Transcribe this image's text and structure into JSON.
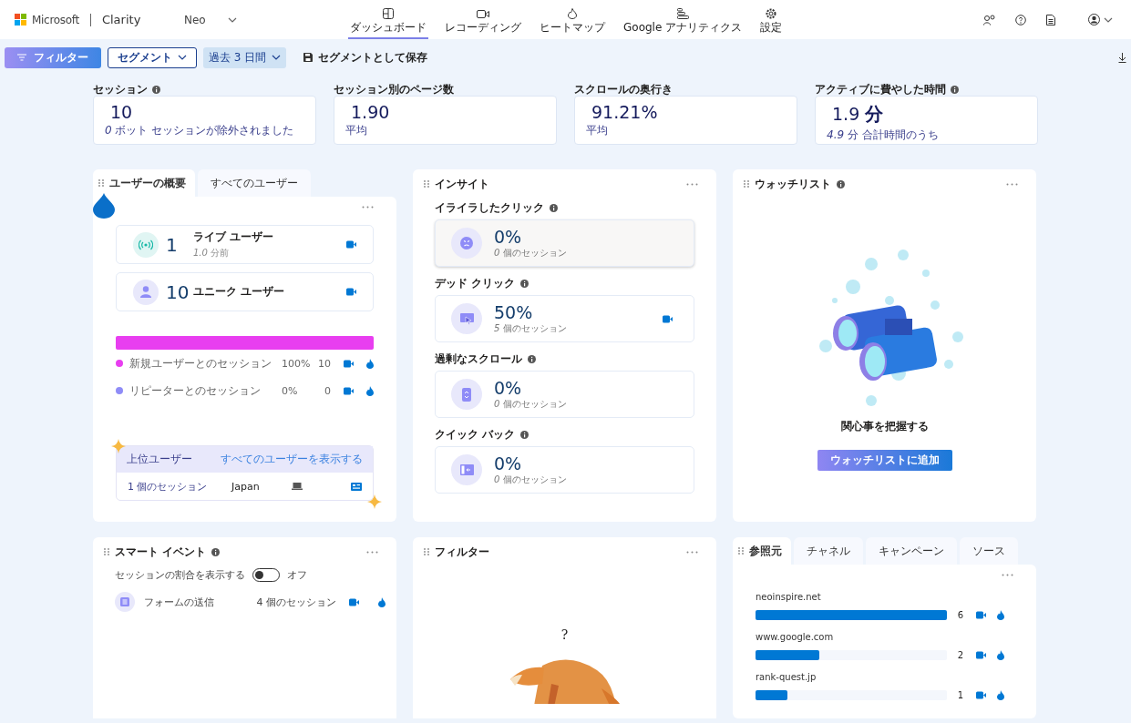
{
  "header": {
    "brand": "Microsoft",
    "product": "Clarity",
    "project": "Neo",
    "nav": [
      {
        "label": "ダッシュボード",
        "selected": true
      },
      {
        "label": "レコーディング",
        "selected": false
      },
      {
        "label": "ヒートマップ",
        "selected": false
      },
      {
        "label": "Google アナリティクス",
        "selected": false
      },
      {
        "label": "設定",
        "selected": false
      }
    ]
  },
  "toolbar": {
    "filter_button": "フィルター",
    "segment_button": "セグメント",
    "date_range": "過去 3 日間",
    "save_segment": "セグメントとして保存"
  },
  "stats": [
    {
      "label": "セッション",
      "info": true,
      "value": "10",
      "note": "*0* ボット セッションが除外されました"
    },
    {
      "label": "セッション別のページ数",
      "info": false,
      "value": "1.90",
      "note": "平均"
    },
    {
      "label": "スクロールの奥行き",
      "info": false,
      "value": "91.21%",
      "note": "平均"
    },
    {
      "label": "アクティブに費やした時間",
      "info": true,
      "value": "1.9 **分**",
      "note": "*4.9* 分 合計時間のうち"
    }
  ],
  "user_overview": {
    "tabs": [
      {
        "label": "ユーザーの概要",
        "selected": true
      },
      {
        "label": "すべてのユーザー",
        "selected": false
      }
    ],
    "users": [
      {
        "value": "1",
        "label": "ライブ ユーザー",
        "sub": "*1.0* 分前"
      },
      {
        "value": "10",
        "label": "ユニーク ユーザー"
      }
    ],
    "segments": [
      {
        "label": "新規ユーザーとのセッション",
        "color": "#e83ef0",
        "level": 1,
        "percent": "100%",
        "count": "10"
      },
      {
        "label": "リピーターとのセッション",
        "color": "#8f8cf7",
        "level": 0,
        "percent": "0%",
        "count": "0"
      }
    ],
    "top_users": {
      "title": "上位ユーザー",
      "link": "すべてのユーザーを表示する",
      "rows": [
        {
          "sessions": "1 個のセッション",
          "country": "Japan"
        }
      ]
    }
  },
  "insights": {
    "title": "インサイト",
    "items": [
      {
        "label": "イライラしたクリック",
        "value": "0%",
        "sub": "*0* 個のセッション",
        "highlighted": true,
        "recording": false
      },
      {
        "label": "デッド クリック",
        "value": "50%",
        "sub": "*5* 個のセッション",
        "highlighted": false,
        "recording": true
      },
      {
        "label": "過剰なスクロール",
        "value": "0%",
        "sub": "*0* 個のセッション",
        "highlighted": false,
        "recording": false
      },
      {
        "label": "クイック バック",
        "value": "0%",
        "sub": "*0* 個のセッション",
        "highlighted": false,
        "recording": false
      }
    ]
  },
  "watchlist": {
    "title": "ウォッチリスト",
    "message": "関心事を把握する",
    "button": "ウォッチリストに追加"
  },
  "smart_events": {
    "title": "スマート イベント",
    "toggle": {
      "label": "セッションの割合を表示する",
      "on": false,
      "state_label": "オフ"
    },
    "events": [
      {
        "name": "フォームの送信",
        "sessions": "4 個のセッション"
      }
    ]
  },
  "filter_card": {
    "title": "フィルター",
    "mark": "?"
  },
  "referrers": {
    "tabs": [
      {
        "label": "参照元",
        "selected": true
      },
      {
        "label": "チャネル",
        "selected": false
      },
      {
        "label": "キャンペーン",
        "selected": false
      },
      {
        "label": "ソース",
        "selected": false
      }
    ],
    "rows": [
      {
        "name": "neoinspire.net",
        "level": 1,
        "count": "6"
      },
      {
        "name": "www.google.com",
        "level": 0.333,
        "count": "2"
      },
      {
        "name": "rank-quest.jp",
        "level": 0.167,
        "count": "1"
      }
    ]
  }
}
